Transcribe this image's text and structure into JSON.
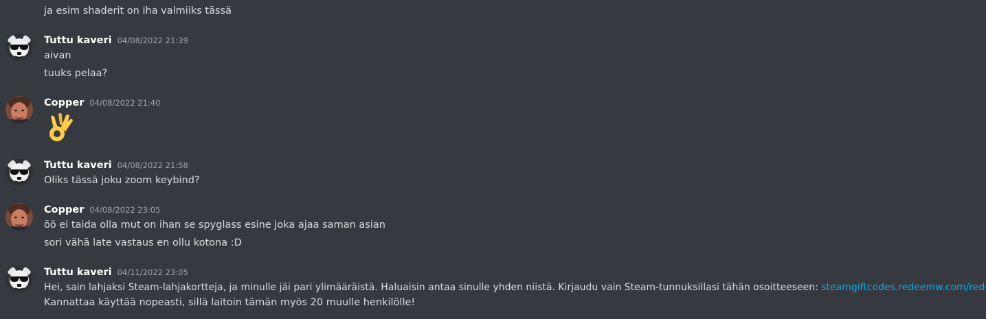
{
  "messages": [
    {
      "continuation": "ja esim shaderit on iha valmiiks tässä"
    },
    {
      "author": "Tuttu kaveri",
      "timestamp": "04/08/2022 21:39",
      "avatar": "skull-sunglasses-icon",
      "lines": [
        "aivan",
        "tuuks pelaa?"
      ]
    },
    {
      "author": "Copper",
      "timestamp": "04/08/2022 21:40",
      "avatar": "man-face-avatar",
      "emoji": "ok-hand-emoji"
    },
    {
      "author": "Tuttu kaveri",
      "timestamp": "04/08/2022 21:58",
      "avatar": "skull-sunglasses-icon",
      "lines": [
        "Oliks tässä joku zoom keybind?"
      ]
    },
    {
      "author": "Copper",
      "timestamp": "04/08/2022 23:05",
      "avatar": "man-face-avatar",
      "lines": [
        "öö ei taida olla mut on ihan se spyglass esine joka ajaa saman asian",
        "sori vähä late vastaus en ollu kotona :D"
      ]
    },
    {
      "author": "Tuttu kaveri",
      "timestamp": "04/11/2022 23:05",
      "avatar": "skull-sunglasses-icon",
      "line1_text": "Hei, sain lahjaksi Steam-lahjakortteja, ja minulle jäi pari ylimääräistä. Haluaisin antaa sinulle yhden niistä. Kirjaudu vain Steam-tunnuksillasi tähän osoitteeseen: ",
      "line1_link": "steamgiftcodes.redeemw.com/redeem",
      "line2": "Kannattaa käyttää nopeasti, sillä laitoin tämän myös 20 muulle henkilölle!"
    }
  ],
  "colors": {
    "background": "#36393f",
    "text": "#dcddde",
    "author": "#ffffff",
    "timestamp": "#a3a6aa",
    "link": "#00aff4"
  }
}
